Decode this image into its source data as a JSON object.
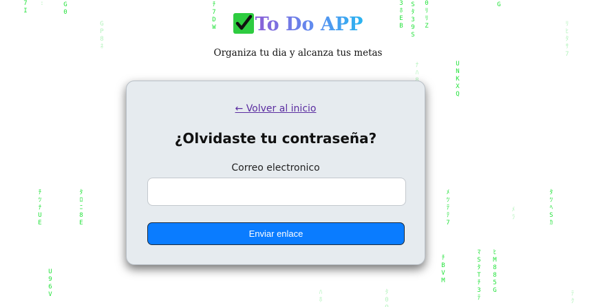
{
  "app": {
    "title": "To Do APP",
    "check_glyph": "✔",
    "subtitle": "Organiza tu dia y alcanza tus metas"
  },
  "recover_card": {
    "back_link": "← Volver al inicio",
    "heading": "¿Olvidaste tu contraseña?",
    "email_label": "Correo electronico",
    "email_value": "",
    "email_placeholder": "",
    "submit_label": "Enviar enlace"
  },
  "background": {
    "style": "matrix-rain",
    "glyph_color": "#22e23a",
    "faded_glyph_color": "#b4f3bd"
  },
  "colors": {
    "primary_button": "#0a7cff",
    "card_background": "#e6ebef",
    "link": "#5a2ca0"
  }
}
